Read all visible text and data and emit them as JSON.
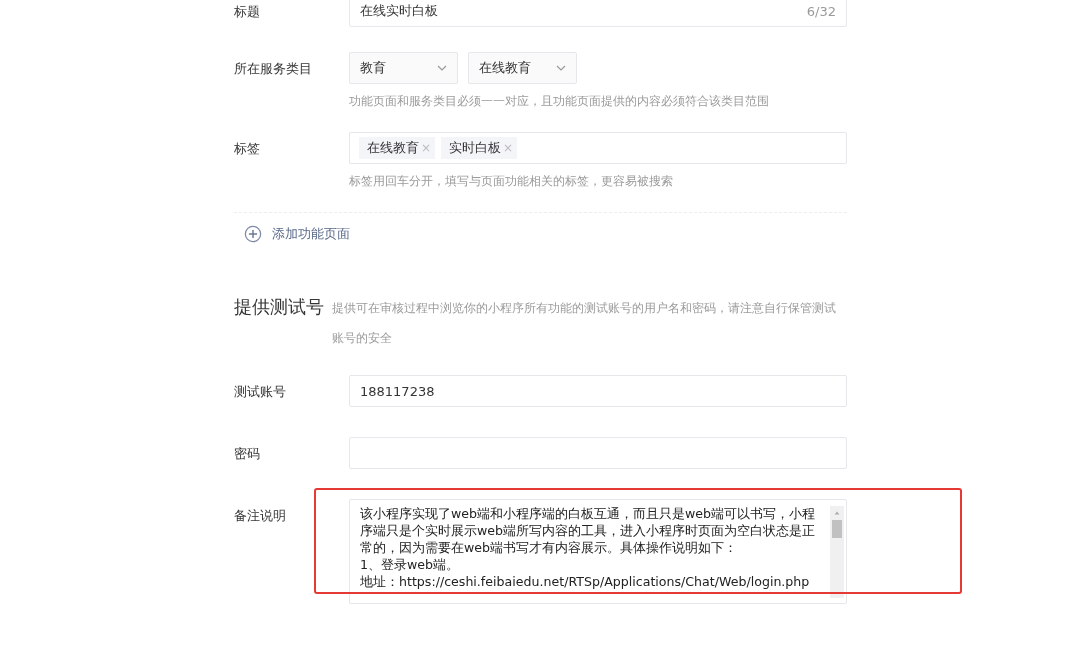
{
  "function_page": {
    "title": {
      "label": "标题",
      "value": "在线实时白板",
      "counter": "6/32"
    },
    "category": {
      "label": "所在服务类目",
      "selects": [
        "教育",
        "在线教育"
      ],
      "hint": "功能页面和服务类目必须一一对应，且功能页面提供的内容必须符合该类目范围"
    },
    "tags": {
      "label": "标签",
      "items": [
        {
          "text": "在线教育",
          "remove": "×"
        },
        {
          "text": "实时白板",
          "remove": "×"
        }
      ],
      "hint": "标签用回车分开，填写与页面功能相关的标签，更容易被搜索"
    }
  },
  "add_page": {
    "label": "添加功能页面"
  },
  "test_account": {
    "heading": "提供测试号",
    "description": "提供可在审核过程中浏览你的小程序所有功能的测试账号的用户名和密码，请注意自行保管测试账号的安全",
    "fields": [
      {
        "label": "测试账号",
        "value": "188117238"
      },
      {
        "label": "密码"
      }
    ],
    "remarks": {
      "label": "备注说明",
      "lines": [
        "该小程序实现了web端和小程序端的白板互通，而且只是web端可以书写，小程序端只是个实时展示web端所写内容的工具，进入小程序时页面为空白状态是正常的，因为需要在web端书写才有内容展示。具体操作说明如下：",
        "1、登录web端。",
        "地址：https://ceshi.feibaiedu.net/RTSp/Applications/Chat/Web/login.php"
      ],
      "highlighted": true
    }
  }
}
